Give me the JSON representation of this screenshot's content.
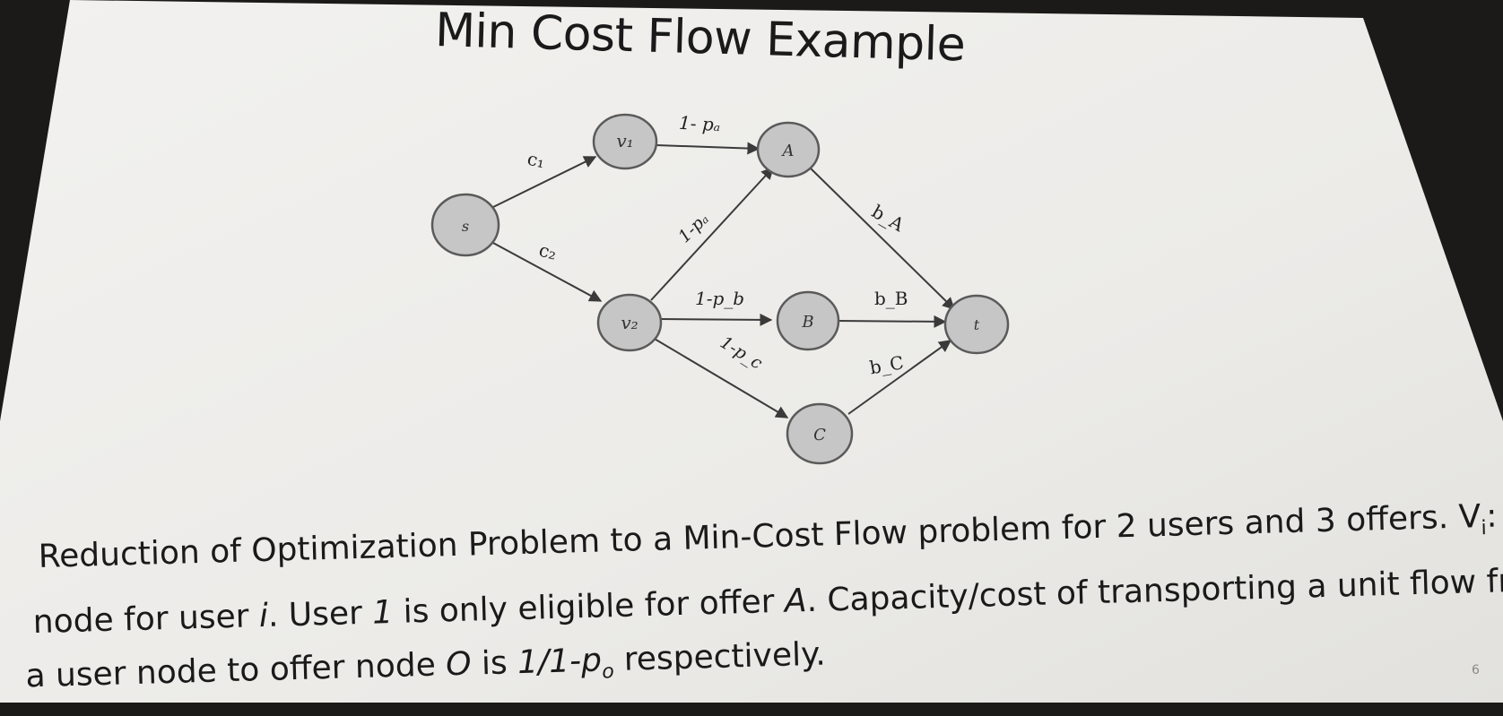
{
  "slide": {
    "title": "Min Cost Flow Example",
    "page_number": "6"
  },
  "graph": {
    "nodes": {
      "s": "s",
      "v1": "v₁",
      "v2": "v₂",
      "A": "A",
      "B": "B",
      "C": "C",
      "t": "t"
    },
    "edges": {
      "s_v1": "c₁",
      "s_v2": "c₂",
      "v1_A": "1- pₐ",
      "v2_A": "1-pₐ",
      "v2_B": "1-p_b",
      "v2_C": "1-p_c",
      "A_t": "b_A",
      "B_t": "b_B",
      "C_t": "b_C"
    }
  },
  "caption": {
    "line1": "Reduction of Optimization Problem to a Min-Cost Flow problem for 2 users and 3 offers. V",
    "line1_sub": "i",
    "line1_end": ":",
    "line2_a": "node for user ",
    "line2_i": "i",
    "line2_b": ". User ",
    "line2_1": "1",
    "line2_c": " is only eligible for offer ",
    "line2_A": "A",
    "line2_d": ". Capacity/cost of transporting a unit flow fro",
    "line3_a": "a user node to offer node ",
    "line3_O": "O",
    "line3_b": " is ",
    "line3_frac": "1/1-p",
    "line3_sub": "o",
    "line3_c": " respectively."
  },
  "colors": {
    "slide_background": "#ecebe8",
    "room_background": "#1b1a18",
    "node_fill": "#c6c6c6",
    "node_stroke": "#5a5a5a",
    "edge": "#3a3a3a",
    "text": "#1a1a1a"
  }
}
